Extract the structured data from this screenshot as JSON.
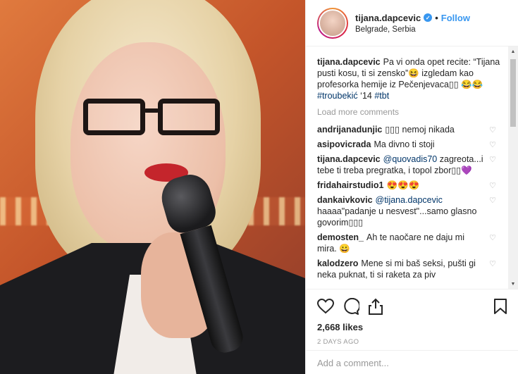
{
  "post": {
    "photo_alt": ""
  },
  "header": {
    "username": "tijana.dapcevic",
    "separator": "•",
    "follow_label": "Follow",
    "location": "Belgrade, Serbia"
  },
  "caption": {
    "username": "tijana.dapcevic",
    "text": "Pa vi onda opet recite: “Tijana pusti kosu, ti si zensko”😆 izgledam kao profesorka hemije iz Pečenjevaca▯▯ 😂😂 ",
    "hashtag1": "#troubekić",
    "text2": " ‘14 ",
    "hashtag2": "#tbt"
  },
  "load_more": "Load more comments",
  "comments": [
    {
      "user": "andrijanadunjic",
      "text": "▯▯▯ nemoj nikada",
      "mention": ""
    },
    {
      "user": "asipovicrada",
      "text": "Ma divno ti stoji",
      "mention": ""
    },
    {
      "user": "tijana.dapcevic",
      "mention": "@quovadis70",
      "text": " zagreota...i tebe ti treba pregratka, i topol zbor▯▯💜"
    },
    {
      "user": "fridahairstudio1",
      "text": "😍😍😍",
      "mention": ""
    },
    {
      "user": "dankaivkovic",
      "mention": "@tijana.dapcevic",
      "text": " haaaa\"padanje u nesvest\"...samo glasno govorim▯▯▯"
    },
    {
      "user": "demosten_",
      "text": "Ah te naočare ne daju mi mira. 😀",
      "mention": ""
    },
    {
      "user": "kalodzero",
      "text": "Mene si mi baš seksi, pušti gi neka puknat, ti si raketa za piv",
      "mention": ""
    }
  ],
  "actions": {
    "likes": "2,668 likes",
    "time": "2 DAYS AGO",
    "add_comment_placeholder": "Add a comment..."
  },
  "icons": [
    "heart-icon",
    "comment-icon",
    "share-icon",
    "bookmark-icon",
    "verified-icon"
  ]
}
